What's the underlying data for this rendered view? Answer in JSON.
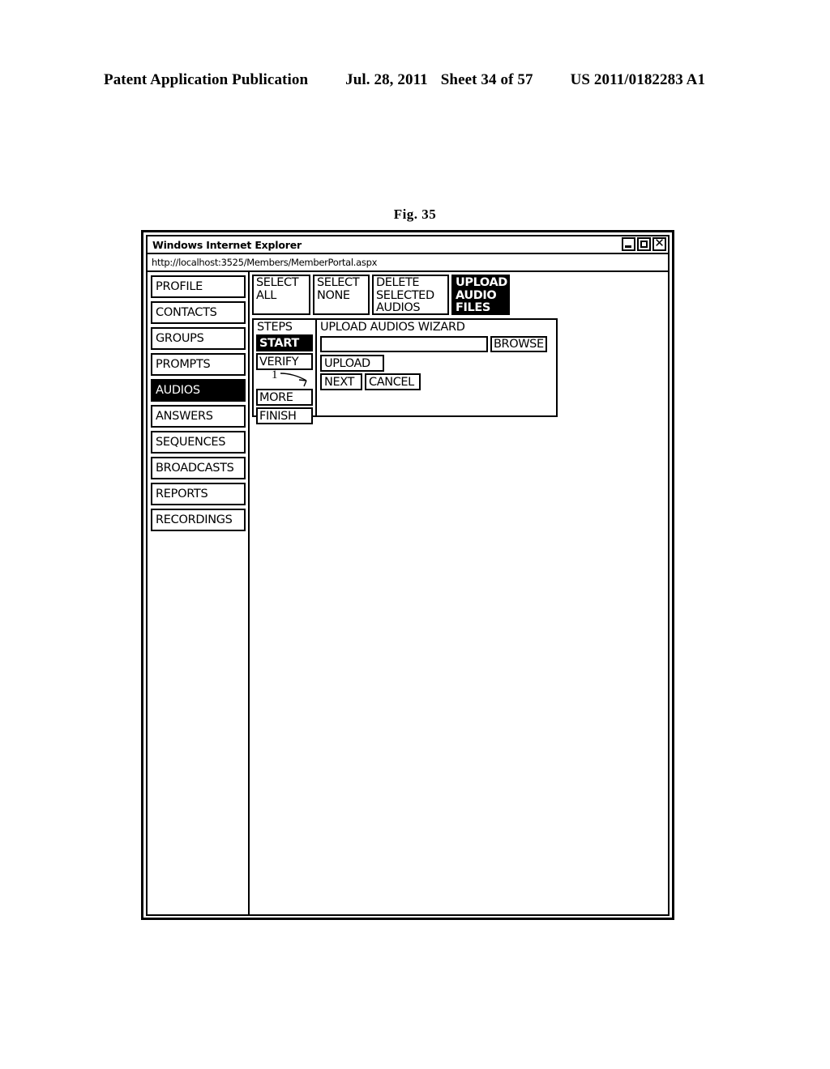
{
  "patent_header": {
    "publication": "Patent Application Publication",
    "date": "Jul. 28, 2011",
    "sheet": "Sheet 34 of 57",
    "patent_number": "US 2011/0182283 A1"
  },
  "figure": {
    "caption": "Fig. 35"
  },
  "browser": {
    "title": "Windows Internet Explorer",
    "url": "http://localhost:3525/Members/MemberPortal.aspx",
    "window_controls": [
      {
        "name": "minimize-button",
        "glyph": "_"
      },
      {
        "name": "maximize-button",
        "glyph": "□"
      },
      {
        "name": "close-button",
        "glyph": "✕"
      }
    ]
  },
  "sidebar": {
    "items": [
      {
        "label": "PROFILE",
        "selected": false
      },
      {
        "label": "CONTACTS",
        "selected": false
      },
      {
        "label": "GROUPS",
        "selected": false
      },
      {
        "label": "PROMPTS",
        "selected": false
      },
      {
        "label": "AUDIOS",
        "selected": true
      },
      {
        "label": "ANSWERS",
        "selected": false
      },
      {
        "label": "SEQUENCES",
        "selected": false
      },
      {
        "label": "BROADCASTS",
        "selected": false
      },
      {
        "label": "REPORTS",
        "selected": false
      },
      {
        "label": "RECORDINGS",
        "selected": false
      }
    ]
  },
  "toolbar": {
    "select_all": "SELECT\nALL",
    "select_none": "SELECT\nNONE",
    "delete_selected_audios": "DELETE\nSELECTED\nAUDIOS",
    "upload_audio_files": "UPLOAD\nAUDIO\nFILES"
  },
  "wizard": {
    "steps_header": "STEPS",
    "title": "UPLOAD AUDIOS WIZARD",
    "steps": [
      {
        "label": "START",
        "selected": true
      },
      {
        "label": "VERIFY",
        "selected": false
      },
      {
        "label": "MORE",
        "selected": false
      },
      {
        "label": "FINISH",
        "selected": false
      }
    ],
    "file_input_value": "",
    "file_input_placeholder": "",
    "browse_label": "BROWSE",
    "upload_label": "UPLOAD",
    "next_label": "NEXT",
    "cancel_label": "CANCEL",
    "callout_number": "1"
  }
}
